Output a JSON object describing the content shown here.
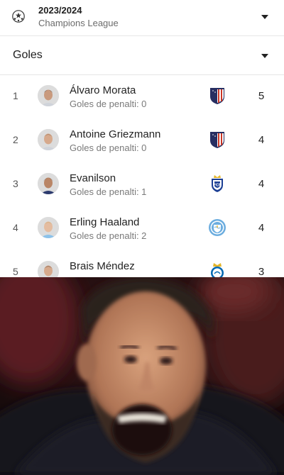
{
  "header": {
    "season": "2023/2024",
    "competition": "Champions League"
  },
  "stat_selector": {
    "label": "Goles"
  },
  "scorers": [
    {
      "rank": "1",
      "name": "Álvaro Morata",
      "penalty_text": "Goles de penalti: 0",
      "team_crest": "atletico-madrid-crest",
      "goals": "5"
    },
    {
      "rank": "2",
      "name": "Antoine Griezmann",
      "penalty_text": "Goles de penalti: 0",
      "team_crest": "atletico-madrid-crest",
      "goals": "4"
    },
    {
      "rank": "3",
      "name": "Evanilson",
      "penalty_text": "Goles de penalti: 1",
      "team_crest": "fc-porto-crest",
      "goals": "4"
    },
    {
      "rank": "4",
      "name": "Erling Haaland",
      "penalty_text": "Goles de penalti: 2",
      "team_crest": "manchester-city-crest",
      "goals": "4"
    },
    {
      "rank": "5",
      "name": "Brais Méndez",
      "penalty_text": "",
      "team_crest": "real-sociedad-crest",
      "goals": "3"
    }
  ],
  "colors": {
    "atletico_red": "#cb3524",
    "atletico_blue": "#272e61",
    "porto_blue": "#1c3f94",
    "city_blue": "#6caddf",
    "sociedad_blue": "#0067b1"
  },
  "icons": {
    "competition": "champions-league-starball-icon",
    "dropdown": "caret-down-icon"
  }
}
